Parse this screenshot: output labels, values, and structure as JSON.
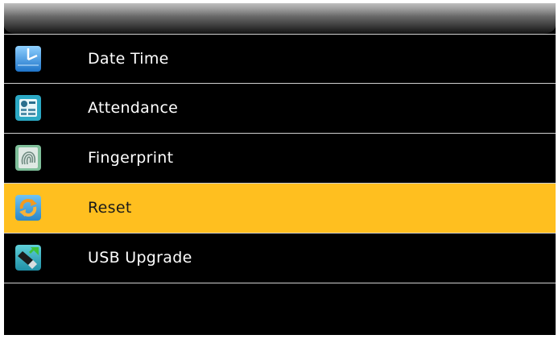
{
  "menu": {
    "items": [
      {
        "label": "Date Time",
        "icon": "clock-calendar-icon",
        "selected": false
      },
      {
        "label": "Attendance",
        "icon": "attendance-table-icon",
        "selected": false
      },
      {
        "label": "Fingerprint",
        "icon": "fingerprint-icon",
        "selected": false
      },
      {
        "label": "Reset",
        "icon": "reset-arrows-icon",
        "selected": true
      },
      {
        "label": "USB Upgrade",
        "icon": "usb-drive-icon",
        "selected": false
      }
    ]
  },
  "colors": {
    "background": "#000000",
    "selected_row": "#ffbf1f",
    "separator": "#cfcfcf",
    "text": "#ffffff",
    "selected_text": "#1a1a1a"
  }
}
